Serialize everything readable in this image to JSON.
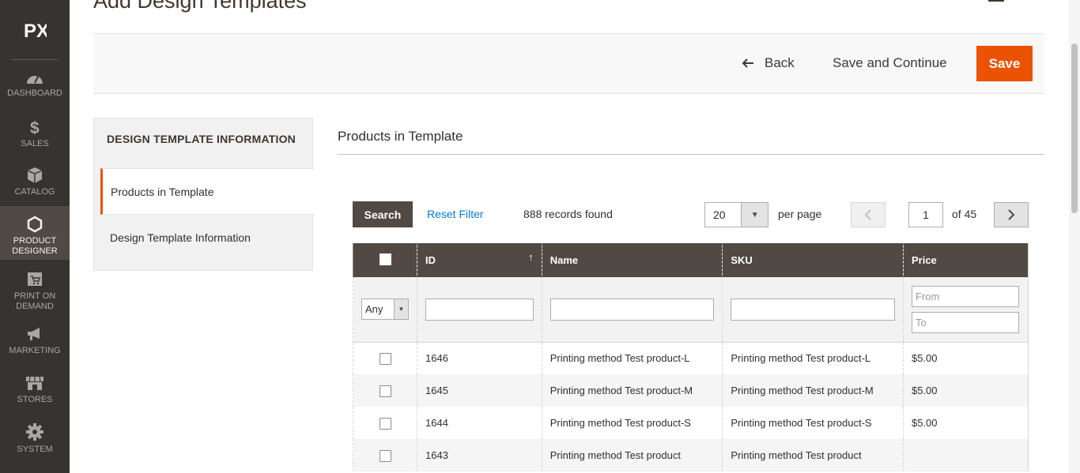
{
  "sidebar": {
    "logo": "PX",
    "items": [
      {
        "label": "DASHBOARD",
        "icon": "dashboard-icon"
      },
      {
        "label": "SALES",
        "icon": "dollar-icon"
      },
      {
        "label": "CATALOG",
        "icon": "box-icon"
      },
      {
        "label": "PRODUCT DESIGNER",
        "icon": "hexagon-icon",
        "active": true
      },
      {
        "label": "PRINT ON DEMAND",
        "icon": "cart-icon"
      },
      {
        "label": "MARKETING",
        "icon": "megaphone-icon"
      },
      {
        "label": "STORES",
        "icon": "store-icon"
      },
      {
        "label": "SYSTEM",
        "icon": "gear-icon"
      }
    ]
  },
  "page": {
    "title": "Add Design Templates"
  },
  "actions": {
    "back": "Back",
    "save_continue": "Save and Continue",
    "save": "Save"
  },
  "tabs": {
    "title": "DESIGN TEMPLATE INFORMATION",
    "items": [
      {
        "label": "Products in Template",
        "active": true
      },
      {
        "label": "Design Template Information",
        "active": false
      }
    ]
  },
  "section": {
    "title": "Products in Template"
  },
  "grid_controls": {
    "search": "Search",
    "reset": "Reset Filter",
    "records": "888 records found",
    "per_page_value": "20",
    "per_page_label": "per page",
    "page_value": "1",
    "page_of": "of 45"
  },
  "table": {
    "columns": [
      "ID",
      "Name",
      "SKU",
      "Price"
    ],
    "filters": {
      "any": "Any",
      "price_from": "From",
      "price_to": "To"
    },
    "rows": [
      {
        "id": "1646",
        "name": "Printing method Test product-L",
        "sku": "Printing method Test product-L",
        "price": "$5.00"
      },
      {
        "id": "1645",
        "name": "Printing method Test product-M",
        "sku": "Printing method Test product-M",
        "price": "$5.00"
      },
      {
        "id": "1644",
        "name": "Printing method Test product-S",
        "sku": "Printing method Test product-S",
        "price": "$5.00"
      },
      {
        "id": "1643",
        "name": "Printing method Test product",
        "sku": "Printing method Test product",
        "price": ""
      }
    ]
  },
  "colors": {
    "accent": "#eb5202",
    "sidebar": "#373330",
    "header": "#514943",
    "link": "#007bdb"
  }
}
